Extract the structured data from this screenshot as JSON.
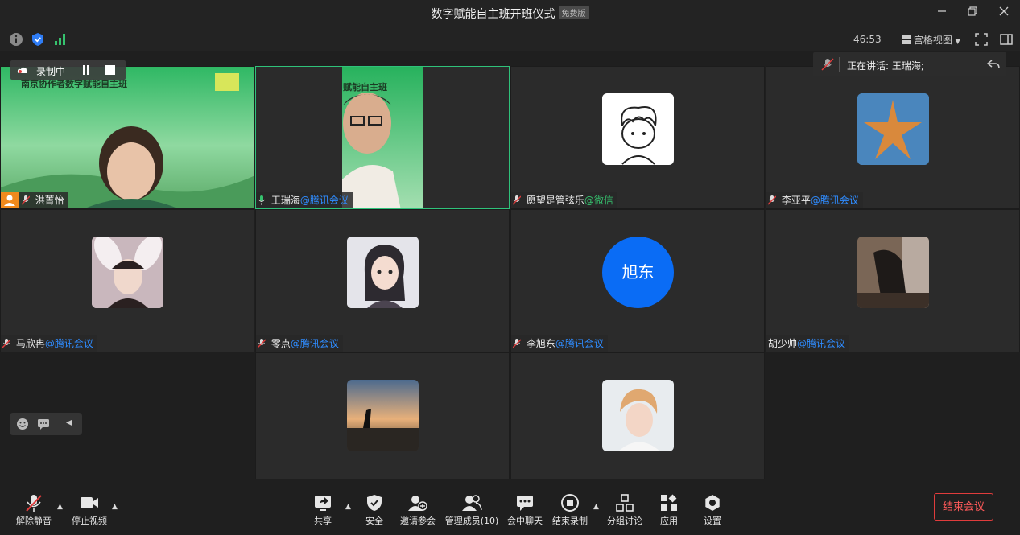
{
  "window": {
    "title": "数字赋能自主班开班仪式",
    "badge": "免费版"
  },
  "status": {
    "timer": "46:53",
    "view_label": "宫格视图"
  },
  "speaking": {
    "text": "正在讲话: 王瑞海;"
  },
  "recording": {
    "label": "录制中"
  },
  "video1": {
    "banner_text": "南京协作者数字赋能自主班",
    "banner_text_2": "赋能自主班"
  },
  "participants": [
    {
      "name": "洪菁怡",
      "org": ""
    },
    {
      "name": "王瑞海",
      "org": "@腾讯会议"
    },
    {
      "name": "愿望是管弦乐",
      "org": "@微信"
    },
    {
      "name": "李亚平",
      "org": "@腾讯会议"
    },
    {
      "name": "马欣冉",
      "org": "@腾讯会议"
    },
    {
      "name": "零点",
      "org": "@腾讯会议"
    },
    {
      "name": "李旭东",
      "org": "@腾讯会议",
      "avatar_text": "旭东"
    },
    {
      "name": "胡少帅",
      "org": "@腾讯会议"
    },
    {
      "name": "",
      "org": ""
    },
    {
      "name": "",
      "org": ""
    }
  ],
  "toolbar": {
    "unmute": "解除静音",
    "stop_video": "停止视频",
    "share": "共享",
    "security": "安全",
    "invite": "邀请参会",
    "members": "管理成员(10)",
    "chat": "会中聊天",
    "end_record": "结束录制",
    "breakout": "分组讨论",
    "apps": "应用",
    "settings": "设置",
    "end_meeting": "结束会议"
  },
  "colors": {
    "accent": "#2f8cff",
    "active_border": "#2fc27a",
    "danger": "#e03c3c"
  }
}
